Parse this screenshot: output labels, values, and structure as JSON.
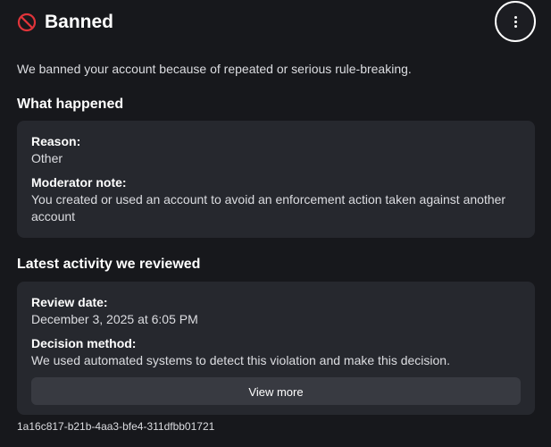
{
  "header": {
    "title": "Banned",
    "icon": "ban-icon",
    "more_icon": "vertical-ellipsis-icon"
  },
  "intro": "We banned your account because of repeated or serious rule-breaking.",
  "what_happened": {
    "title": "What happened",
    "reason_label": "Reason:",
    "reason_value": "Other",
    "note_label": "Moderator note:",
    "note_value": "You created or used an account to avoid an enforcement action taken against another account"
  },
  "latest_activity": {
    "title": "Latest activity we reviewed",
    "review_date_label": "Review date:",
    "review_date_value": "December 3, 2025 at 6:05 PM",
    "decision_label": "Decision method:",
    "decision_value": "We used automated systems to detect this violation and make this decision.",
    "view_more_label": "View more"
  },
  "reference_id": "1a16c817-b21b-4aa3-bfe4-311dfbb01721",
  "colors": {
    "background": "#17181c",
    "card": "#26282e",
    "button": "#383a41",
    "ban_red": "#e0343a"
  }
}
